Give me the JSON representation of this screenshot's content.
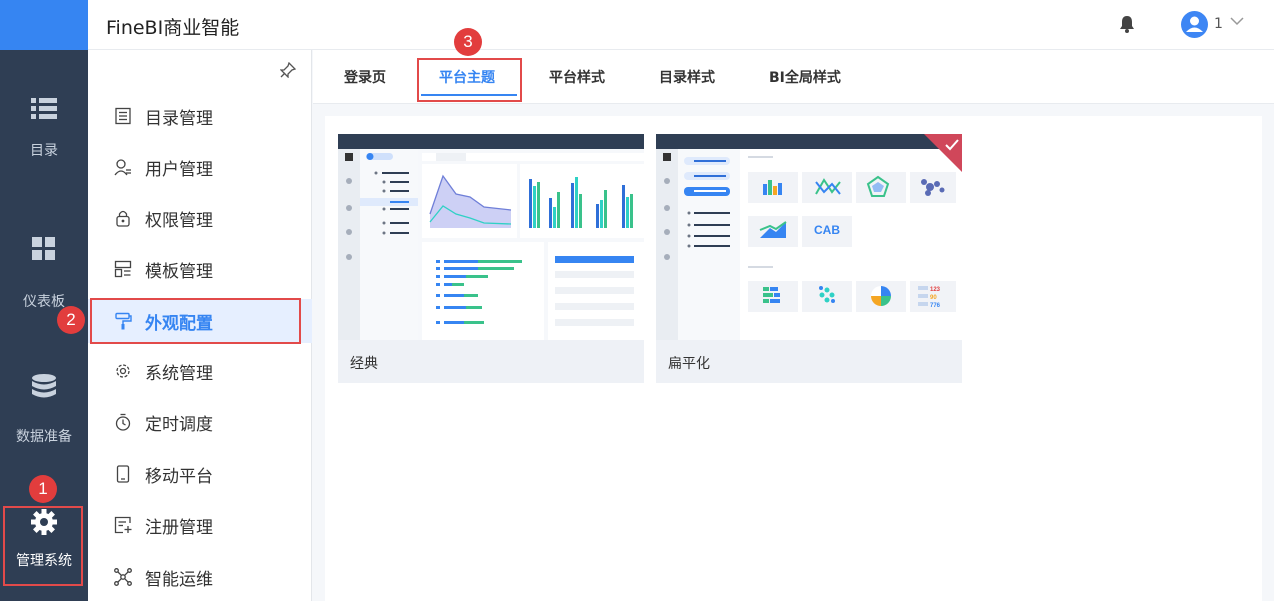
{
  "app": {
    "title": "FineBI商业智能"
  },
  "header": {
    "user_name": "1"
  },
  "rail": {
    "items": [
      {
        "label": "目录",
        "icon": "list-icon"
      },
      {
        "label": "仪表板",
        "icon": "dashboard-icon"
      },
      {
        "label": "数据准备",
        "icon": "database-icon"
      },
      {
        "label": "管理系统",
        "icon": "gear-icon"
      }
    ]
  },
  "menu": {
    "items": [
      {
        "label": "目录管理",
        "icon": "catalog-icon"
      },
      {
        "label": "用户管理",
        "icon": "user-icon"
      },
      {
        "label": "权限管理",
        "icon": "lock-icon"
      },
      {
        "label": "模板管理",
        "icon": "template-icon"
      },
      {
        "label": "外观配置",
        "icon": "paint-roller-icon"
      },
      {
        "label": "系统管理",
        "icon": "gear-icon"
      },
      {
        "label": "定时调度",
        "icon": "timer-icon"
      },
      {
        "label": "移动平台",
        "icon": "mobile-icon"
      },
      {
        "label": "注册管理",
        "icon": "register-icon"
      },
      {
        "label": "智能运维",
        "icon": "network-icon"
      }
    ],
    "active_index": 4
  },
  "tabs": [
    "登录页",
    "平台主题",
    "平台样式",
    "目录样式",
    "BI全局样式"
  ],
  "active_tab": 1,
  "themes": [
    {
      "name": "经典",
      "selected": false
    },
    {
      "name": "扁平化",
      "selected": true
    }
  ],
  "annotations": [
    "1",
    "2",
    "3"
  ],
  "colors": {
    "accent": "#3685f2",
    "rail": "#2f3e54",
    "annotation": "#e23d3d",
    "chart_teal": "#2fd1c5",
    "chart_green": "#3ac28b"
  },
  "preview_text": {
    "cab": "CAB",
    "n1": "123",
    "n2": "90",
    "n3": "776"
  }
}
